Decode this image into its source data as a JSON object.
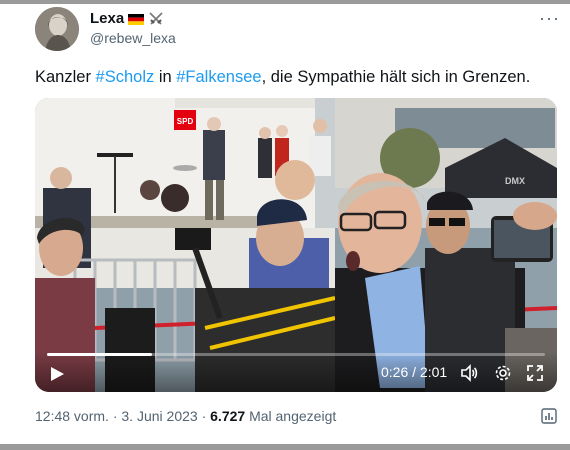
{
  "author": {
    "display_name": "Lexa",
    "handle": "@rebew_lexa",
    "flag_icon": "germany-flag-icon",
    "badge_icon": "crossed-swords-icon",
    "avatar_icon": "avatar-photo"
  },
  "more_icon": "more-horizontal-icon",
  "more_label": "···",
  "tweet": {
    "text_prefix": "Kanzler ",
    "hashtag_1": "#Scholz",
    "text_mid": " in ",
    "hashtag_2": "#Falkensee",
    "text_suffix": ", die Sympathie hält sich in Grenzen."
  },
  "video": {
    "elapsed": "0:26",
    "duration": "2:01",
    "time_display": "0:26 / 2:01",
    "progress_fraction": 0.21,
    "scene_labels": {
      "spd_sign": "SPD",
      "tent_text": "DMX"
    },
    "icons": [
      "play-icon",
      "volume-icon",
      "settings-icon",
      "fullscreen-icon"
    ]
  },
  "meta": {
    "time": "12:48 vorm.",
    "separator": " · ",
    "date": "3. Juni 2023",
    "views_count": "6.727",
    "views_label": " Mal angezeigt"
  },
  "colors": {
    "link": "#1d9bf0",
    "secondary_text": "#536471",
    "primary_text": "#0f1419"
  }
}
